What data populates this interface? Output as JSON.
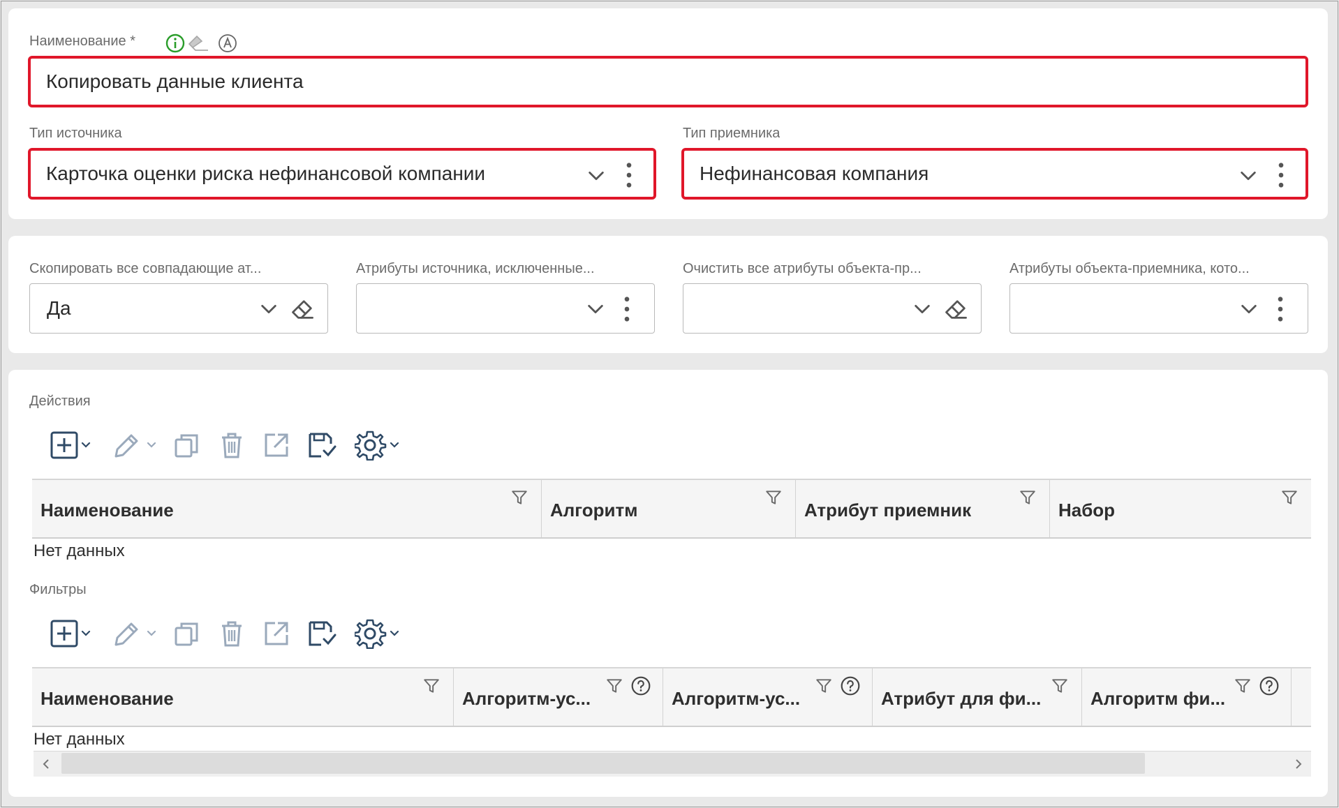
{
  "main": {
    "name_label": "Наименование *",
    "name_value": "Копировать данные клиента",
    "source_type_label": "Тип источника",
    "source_type_value": "Карточка оценки риска нефинансовой компании",
    "target_type_label": "Тип приемника",
    "target_type_value": "Нефинансовая компания"
  },
  "options": {
    "copy_all_label": "Скопировать все совпадающие ат...",
    "copy_all_value": "Да",
    "excluded_label": "Атрибуты источника, исключенные...",
    "excluded_value": "",
    "clear_all_label": "Очистить все атрибуты объекта-пр...",
    "clear_all_value": "",
    "target_attrs_label": "Атрибуты объекта-приемника, кото...",
    "target_attrs_value": ""
  },
  "actions": {
    "title": "Действия",
    "columns": [
      "Наименование",
      "Алгоритм",
      "Атрибут приемник",
      "Набор"
    ],
    "empty": "Нет данных"
  },
  "filters": {
    "title": "Фильтры",
    "columns": [
      "Наименование",
      "Алгоритм-ус...",
      "Алгоритм-ус...",
      "Атрибут для фи...",
      "Алгоритм фи..."
    ],
    "empty": "Нет данных"
  },
  "colors": {
    "error": "#e0172a",
    "info": "#2a9d2a",
    "icon": "#2f4a66"
  }
}
